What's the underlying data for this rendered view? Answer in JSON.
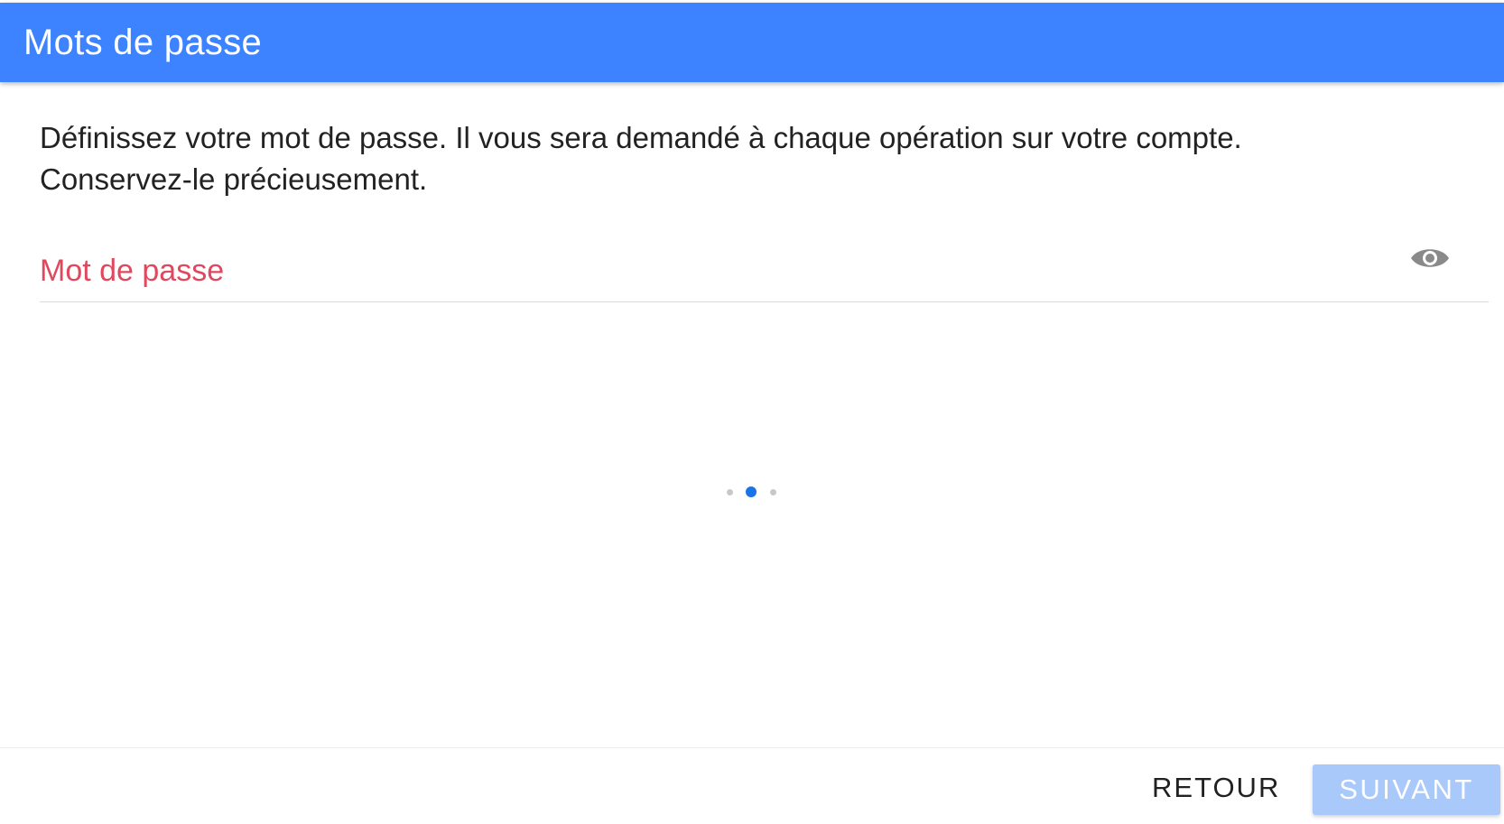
{
  "header": {
    "title": "Mots de passe",
    "background_color": "#3d83ff"
  },
  "intro": {
    "line1": "Définissez votre mot de passe. Il vous sera demandé à chaque opération sur votre compte.",
    "line2": "Conservez-le précieusement."
  },
  "password_field": {
    "value": "",
    "placeholder": "Mot de passe",
    "placeholder_color": "#e0485e",
    "visibility_icon": "eye-icon"
  },
  "progress": {
    "steps": 3,
    "current_step": 2,
    "active_color": "#1a73e8",
    "inactive_color": "#c8c8c8"
  },
  "footer": {
    "back_label": "RETOUR",
    "next_label": "SUIVANT",
    "next_enabled": false
  }
}
